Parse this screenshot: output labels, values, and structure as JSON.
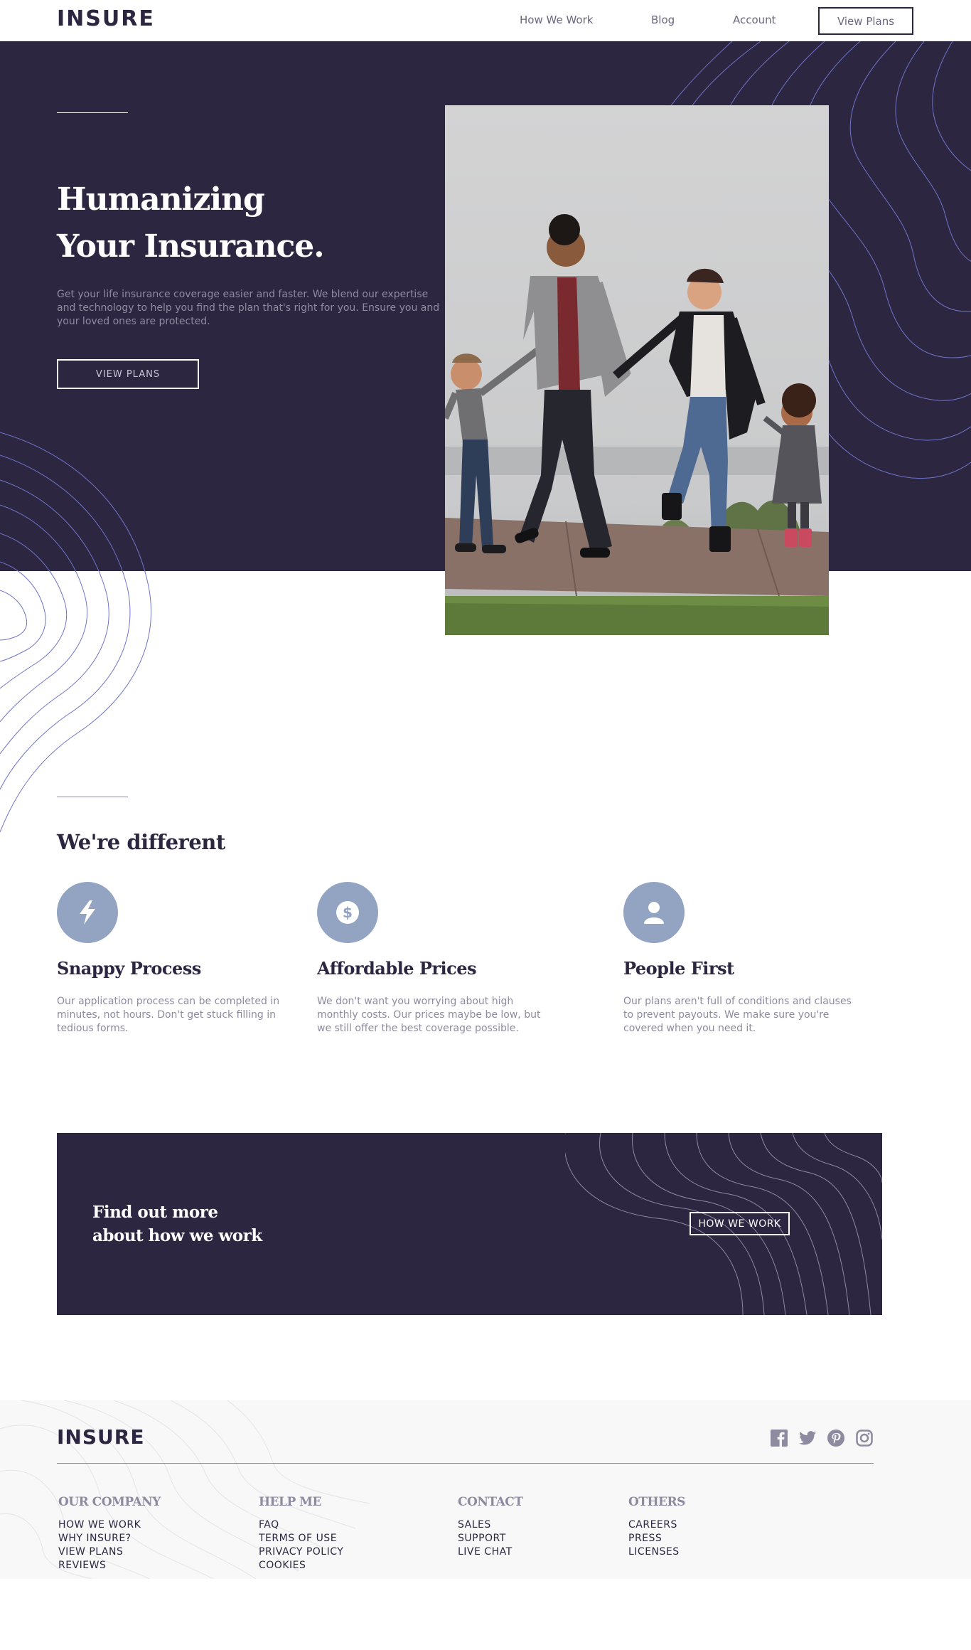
{
  "header": {
    "logo": "INSURE",
    "nav": [
      {
        "label": "How We Work"
      },
      {
        "label": "Blog"
      },
      {
        "label": "Account"
      }
    ],
    "cta_label": "View Plans"
  },
  "hero": {
    "title_line1": "Humanizing",
    "title_line2": "Your Insurance.",
    "text": "Get your life insurance coverage easier and faster. We blend our expertise and technology to help you find the plan that's right for you. Ensure you and your loved ones are protected.",
    "button_label": "VIEW PLANS"
  },
  "different": {
    "title": "We're different",
    "features": [
      {
        "icon": "lightning-icon",
        "title": "Snappy Process",
        "text": "Our application process can be completed in minutes, not hours. Don't get stuck filling in tedious forms."
      },
      {
        "icon": "dollar-icon",
        "title": "Affordable Prices",
        "text": "We don't want you worrying about high monthly costs. Our prices maybe be low, but we still offer the best coverage possible."
      },
      {
        "icon": "person-icon",
        "title": "People First",
        "text": "Our plans aren't full of conditions and clauses to prevent payouts. We make sure you're covered when you need it."
      }
    ]
  },
  "cta": {
    "title_line1": "Find out more",
    "title_line2": "about how we work",
    "button_label": "HOW WE WORK"
  },
  "footer": {
    "logo": "INSURE",
    "social": [
      "facebook-icon",
      "twitter-icon",
      "pinterest-icon",
      "instagram-icon"
    ],
    "columns": [
      {
        "title": "OUR COMPANY",
        "links": [
          "HOW WE WORK",
          "WHY INSURE?",
          "VIEW PLANS",
          "REVIEWS"
        ]
      },
      {
        "title": "HELP ME",
        "links": [
          "FAQ",
          "TERMS OF USE",
          "PRIVACY POLICY",
          "COOKIES"
        ]
      },
      {
        "title": "CONTACT",
        "links": [
          "SALES",
          "SUPPORT",
          "LIVE CHAT"
        ]
      },
      {
        "title": "OTHERS",
        "links": [
          "CAREERS",
          "PRESS",
          "LICENSES"
        ]
      }
    ]
  },
  "colors": {
    "dark_violet": "#2c2640",
    "grayish_violet": "#8e8aa0",
    "icon_blue": "#93a3c2",
    "footer_bg": "#f8f8f8"
  }
}
